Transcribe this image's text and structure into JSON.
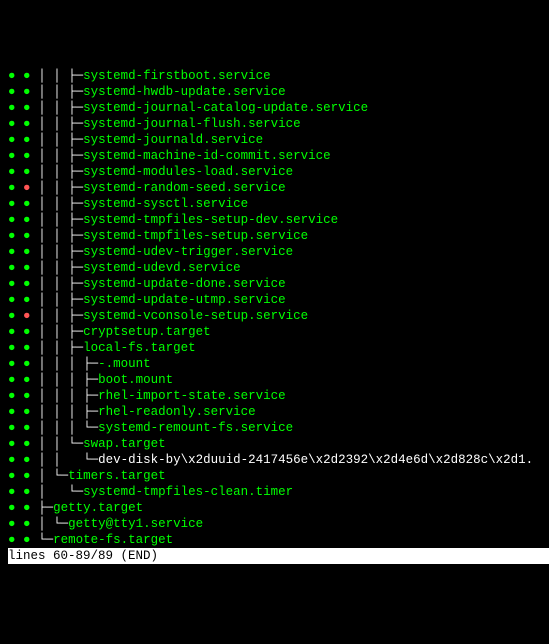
{
  "lines": [
    {
      "dots": [
        "g",
        "g"
      ],
      "tree": "│ │ ├─",
      "name": "systemd-firstboot.service",
      "cls": "name"
    },
    {
      "dots": [
        "g",
        "g"
      ],
      "tree": "│ │ ├─",
      "name": "systemd-hwdb-update.service",
      "cls": "name"
    },
    {
      "dots": [
        "g",
        "g"
      ],
      "tree": "│ │ ├─",
      "name": "systemd-journal-catalog-update.service",
      "cls": "name"
    },
    {
      "dots": [
        "g",
        "g"
      ],
      "tree": "│ │ ├─",
      "name": "systemd-journal-flush.service",
      "cls": "name"
    },
    {
      "dots": [
        "g",
        "g"
      ],
      "tree": "│ │ ├─",
      "name": "systemd-journald.service",
      "cls": "name"
    },
    {
      "dots": [
        "g",
        "g"
      ],
      "tree": "│ │ ├─",
      "name": "systemd-machine-id-commit.service",
      "cls": "name"
    },
    {
      "dots": [
        "g",
        "g"
      ],
      "tree": "│ │ ├─",
      "name": "systemd-modules-load.service",
      "cls": "name"
    },
    {
      "dots": [
        "g",
        "r"
      ],
      "tree": "│ │ ├─",
      "name": "systemd-random-seed.service",
      "cls": "name"
    },
    {
      "dots": [
        "g",
        "g"
      ],
      "tree": "│ │ ├─",
      "name": "systemd-sysctl.service",
      "cls": "name"
    },
    {
      "dots": [
        "g",
        "g"
      ],
      "tree": "│ │ ├─",
      "name": "systemd-tmpfiles-setup-dev.service",
      "cls": "name"
    },
    {
      "dots": [
        "g",
        "g"
      ],
      "tree": "│ │ ├─",
      "name": "systemd-tmpfiles-setup.service",
      "cls": "name"
    },
    {
      "dots": [
        "g",
        "g"
      ],
      "tree": "│ │ ├─",
      "name": "systemd-udev-trigger.service",
      "cls": "name"
    },
    {
      "dots": [
        "g",
        "g"
      ],
      "tree": "│ │ ├─",
      "name": "systemd-udevd.service",
      "cls": "name"
    },
    {
      "dots": [
        "g",
        "g"
      ],
      "tree": "│ │ ├─",
      "name": "systemd-update-done.service",
      "cls": "name"
    },
    {
      "dots": [
        "g",
        "g"
      ],
      "tree": "│ │ ├─",
      "name": "systemd-update-utmp.service",
      "cls": "name"
    },
    {
      "dots": [
        "g",
        "r"
      ],
      "tree": "│ │ ├─",
      "name": "systemd-vconsole-setup.service",
      "cls": "name"
    },
    {
      "dots": [
        "g",
        "g"
      ],
      "tree": "│ │ ├─",
      "name": "cryptsetup.target",
      "cls": "name"
    },
    {
      "dots": [
        "g",
        "g"
      ],
      "tree": "│ │ ├─",
      "name": "local-fs.target",
      "cls": "name"
    },
    {
      "dots": [
        "g",
        "g"
      ],
      "tree": "│ │ │ ├─",
      "name": "-.mount",
      "cls": "name"
    },
    {
      "dots": [
        "g",
        "g"
      ],
      "tree": "│ │ │ ├─",
      "name": "boot.mount",
      "cls": "name"
    },
    {
      "dots": [
        "g",
        "g"
      ],
      "tree": "│ │ │ ├─",
      "name": "rhel-import-state.service",
      "cls": "name"
    },
    {
      "dots": [
        "g",
        "g"
      ],
      "tree": "│ │ │ ├─",
      "name": "rhel-readonly.service",
      "cls": "name"
    },
    {
      "dots": [
        "g",
        "g"
      ],
      "tree": "│ │ │ └─",
      "name": "systemd-remount-fs.service",
      "cls": "name"
    },
    {
      "dots": [
        "g",
        "g"
      ],
      "tree": "│ │ └─",
      "name": "swap.target",
      "cls": "name"
    },
    {
      "dots": [
        "g",
        "g"
      ],
      "tree": "│ │   └─",
      "name": "dev-disk-by\\x2duuid-2417456e\\x2d2392\\x2d4e6d\\x2d828c\\x2d1.",
      "cls": "name-w"
    },
    {
      "dots": [
        "g",
        "g"
      ],
      "tree": "│ └─",
      "name": "timers.target",
      "cls": "name"
    },
    {
      "dots": [
        "g",
        "g"
      ],
      "tree": "│   └─",
      "name": "systemd-tmpfiles-clean.timer",
      "cls": "name"
    },
    {
      "dots": [
        "g",
        "g"
      ],
      "tree": "├─",
      "name": "getty.target",
      "cls": "name"
    },
    {
      "dots": [
        "g",
        "g"
      ],
      "tree": "│ └─",
      "name": "getty@tty1.service",
      "cls": "name"
    },
    {
      "dots": [
        "g",
        "g"
      ],
      "tree": "└─",
      "name": "remote-fs.target",
      "cls": "name"
    }
  ],
  "status": "lines 60-89/89 (END)"
}
